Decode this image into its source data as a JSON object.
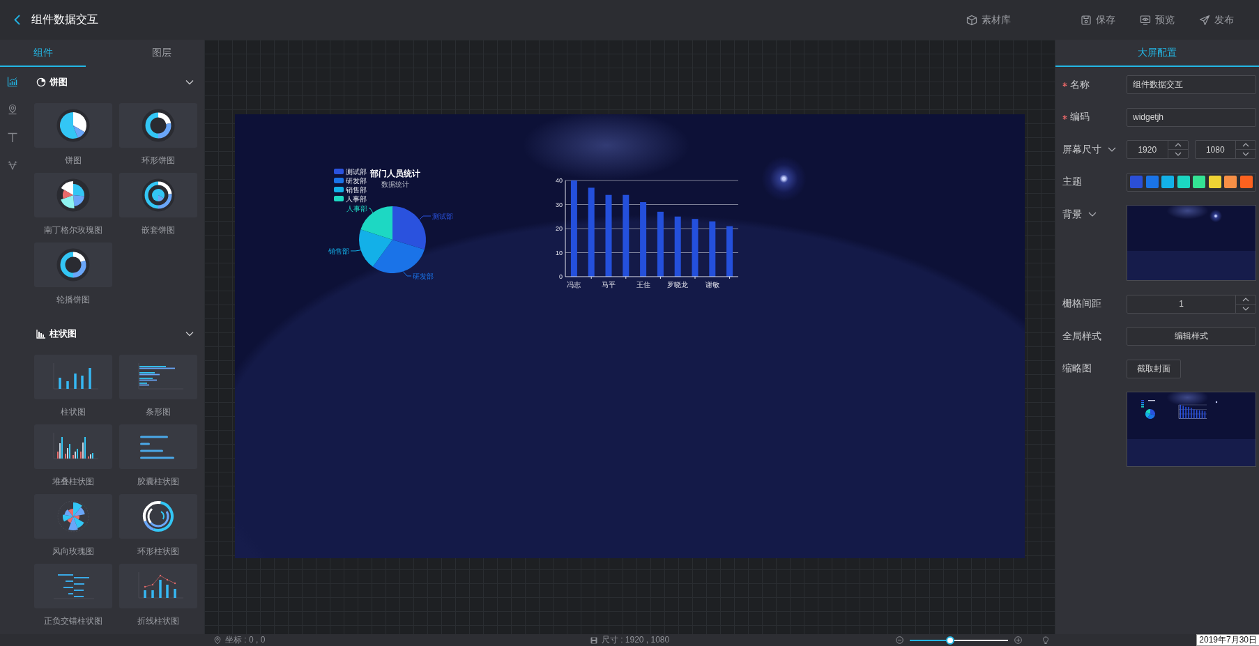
{
  "header": {
    "title": "组件数据交互",
    "actions": [
      {
        "kind": "materials",
        "label": "素材库"
      },
      {
        "kind": "save",
        "label": "保存"
      },
      {
        "kind": "preview",
        "label": "预览"
      },
      {
        "kind": "publish",
        "label": "发布"
      }
    ]
  },
  "left_panel": {
    "tabs": [
      {
        "label": "组件",
        "selected": true
      },
      {
        "label": "图层",
        "selected": false
      }
    ],
    "category_icons": [
      {
        "kind": "chart",
        "selected": true
      },
      {
        "kind": "map",
        "selected": false
      },
      {
        "kind": "text",
        "selected": false
      },
      {
        "kind": "deer",
        "selected": false
      }
    ],
    "groups": [
      {
        "kind": "pie",
        "title": "饼图",
        "expanded": true,
        "items": [
          {
            "kind": "pie",
            "label": "饼图"
          },
          {
            "kind": "donut",
            "label": "环形饼图"
          },
          {
            "kind": "rose",
            "label": "南丁格尔玫瑰图"
          },
          {
            "kind": "nested",
            "label": "嵌套饼图"
          },
          {
            "kind": "carousel",
            "label": "轮播饼图"
          }
        ]
      },
      {
        "kind": "bar",
        "title": "柱状图",
        "expanded": true,
        "items": [
          {
            "kind": "bar",
            "label": "柱状图"
          },
          {
            "kind": "hbar",
            "label": "条形图"
          },
          {
            "kind": "stacked",
            "label": "堆叠柱状图"
          },
          {
            "kind": "capsule",
            "label": "胶囊柱状图"
          },
          {
            "kind": "windrose",
            "label": "风向玫瑰图"
          },
          {
            "kind": "radial",
            "label": "环形柱状图"
          },
          {
            "kind": "diverging",
            "label": "正负交错柱状图"
          },
          {
            "kind": "linebar",
            "label": "折线柱状图"
          }
        ]
      }
    ]
  },
  "screen": {
    "widgets": [
      {
        "kind": "pie",
        "title": "部门人员统计",
        "subtitle": "数据统计",
        "legend": [
          {
            "name": "测试部",
            "color": "#2a52de"
          },
          {
            "name": "研发部",
            "color": "#1a73e8"
          },
          {
            "name": "销售部",
            "color": "#13b0e8"
          },
          {
            "name": "人事部",
            "color": "#1dd8c3"
          }
        ],
        "slices": [
          {
            "label": "测试部",
            "color": "#2a52de"
          },
          {
            "label": "研发部",
            "color": "#1a73e8"
          },
          {
            "label": "销售部",
            "color": "#13b0e8"
          },
          {
            "label": "人事部",
            "color": "#1dd8c3"
          }
        ]
      },
      {
        "kind": "bar",
        "chart_data": {
          "type": "bar",
          "categories": [
            "冯志",
            null,
            "马平",
            null,
            "王住",
            null,
            "罗晓龙",
            null,
            "谢敏",
            null
          ],
          "series": [
            {
              "color": "#2450dc",
              "values": [
                40,
                37,
                34,
                34,
                31,
                27,
                25,
                24,
                23,
                21
              ]
            }
          ],
          "ylim": [
            0,
            40
          ],
          "yticks": [
            0,
            10,
            20,
            30,
            40
          ],
          "grid": true
        }
      }
    ]
  },
  "right_panel": {
    "tabs": [
      {
        "label": "大屏配置",
        "selected": true
      }
    ],
    "fields": [
      {
        "kind": "text",
        "label": "名称",
        "required": true,
        "dropdown": false,
        "value": "组件数据交互"
      },
      {
        "kind": "text",
        "label": "编码",
        "required": true,
        "dropdown": false,
        "value": "widgetjh"
      },
      {
        "kind": "size",
        "label": "屏幕尺寸",
        "required": false,
        "dropdown": true,
        "values": [
          "1920",
          "1080"
        ]
      },
      {
        "kind": "palette",
        "label": "主题",
        "required": false,
        "dropdown": false,
        "swatches": [
          {
            "color": "#2b4fd7"
          },
          {
            "color": "#1a74e8"
          },
          {
            "color": "#13b1e8"
          },
          {
            "color": "#1bd6c2"
          },
          {
            "color": "#34e394"
          },
          {
            "color": "#efd334"
          },
          {
            "color": "#f68f46"
          },
          {
            "color": "#fc621f"
          }
        ]
      },
      {
        "kind": "image",
        "label": "背景",
        "required": false,
        "dropdown": true
      },
      {
        "kind": "number",
        "label": "栅格间距",
        "required": false,
        "dropdown": false,
        "value": "1"
      },
      {
        "kind": "button",
        "label": "全局样式",
        "required": false,
        "dropdown": false,
        "button": "编辑样式"
      },
      {
        "kind": "cover",
        "label": "缩略图",
        "required": false,
        "dropdown": false,
        "button": "截取封面"
      }
    ]
  },
  "status_bar": {
    "coordinates": "坐标 : 0 , 0",
    "size": "尺寸 : 1920 , 1080",
    "zoom": {
      "level": 0.4
    },
    "date": "2019年7月30日"
  }
}
